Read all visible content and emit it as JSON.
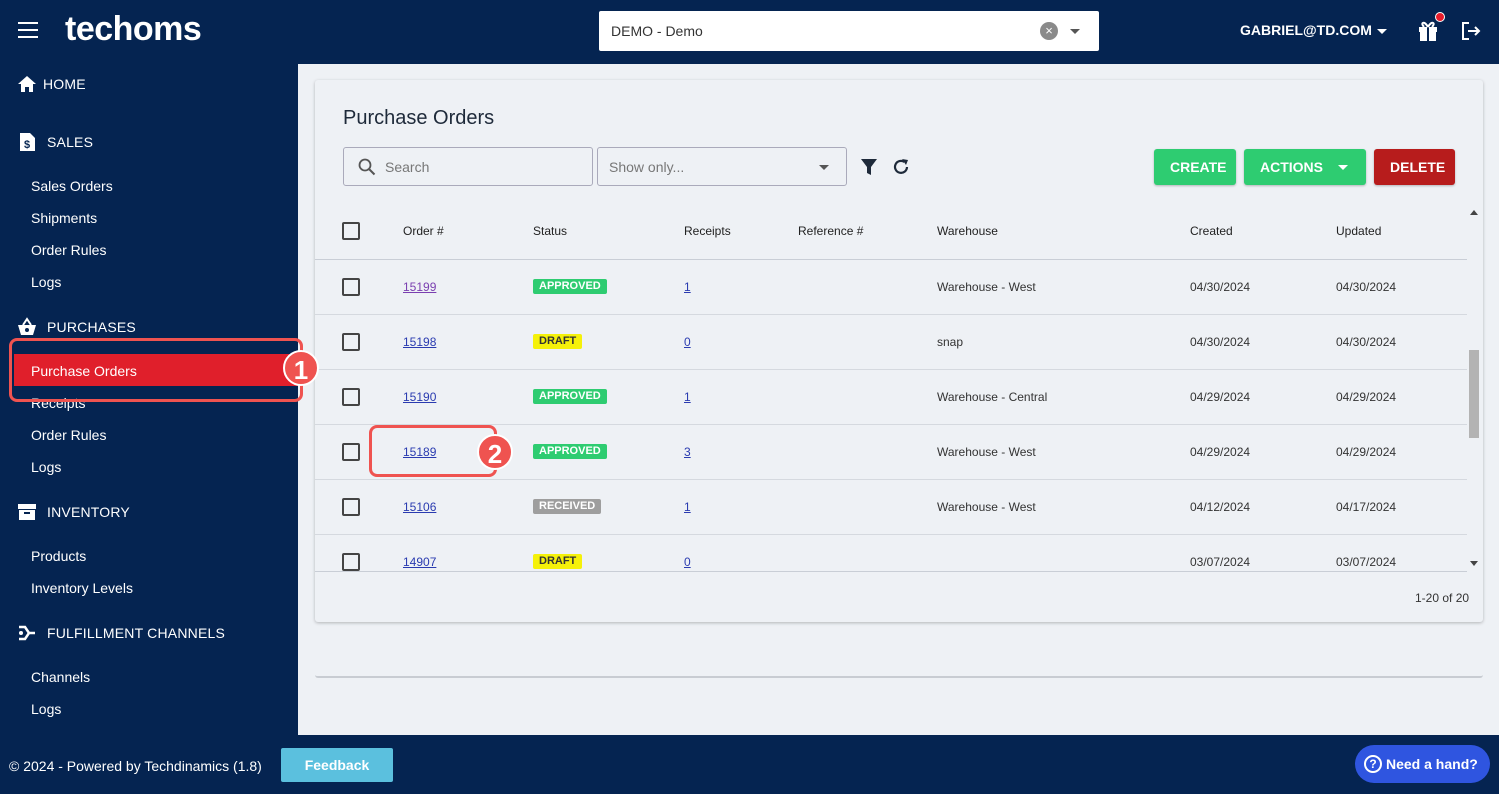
{
  "header": {
    "logo": "techoms",
    "company_select_value": "DEMO - Demo",
    "user": "GABRIEL@TD.COM"
  },
  "sidebar": {
    "sections": [
      {
        "label": "HOME",
        "icon": "home-icon"
      },
      {
        "label": "SALES",
        "icon": "dollar-file-icon",
        "items": [
          "Sales Orders",
          "Shipments",
          "Order Rules",
          "Logs"
        ]
      },
      {
        "label": "PURCHASES",
        "icon": "basket-icon",
        "items": [
          "Purchase Orders",
          "Receipts",
          "Order Rules",
          "Logs"
        ]
      },
      {
        "label": "INVENTORY",
        "icon": "archive-icon",
        "items": [
          "Products",
          "Inventory Levels"
        ]
      },
      {
        "label": "FULFILLMENT CHANNELS",
        "icon": "channels-icon",
        "items": [
          "Channels",
          "Logs"
        ]
      }
    ],
    "active_item": "Purchase Orders"
  },
  "main": {
    "title": "Purchase Orders",
    "search_placeholder": "Search",
    "show_only_placeholder": "Show only...",
    "buttons": {
      "create": "CREATE",
      "actions": "ACTIONS",
      "delete": "DELETE"
    },
    "columns": [
      "Order #",
      "Status",
      "Receipts",
      "Reference #",
      "Warehouse",
      "Created",
      "Updated"
    ],
    "rows": [
      {
        "order": "15199",
        "status": "APPROVED",
        "receipts": "1",
        "reference": "",
        "warehouse": "Warehouse - West",
        "created": "04/30/2024",
        "updated": "04/30/2024"
      },
      {
        "order": "15198",
        "status": "DRAFT",
        "receipts": "0",
        "reference": "",
        "warehouse": "snap",
        "created": "04/30/2024",
        "updated": "04/30/2024"
      },
      {
        "order": "15190",
        "status": "APPROVED",
        "receipts": "1",
        "reference": "",
        "warehouse": "Warehouse - Central",
        "created": "04/29/2024",
        "updated": "04/29/2024"
      },
      {
        "order": "15189",
        "status": "APPROVED",
        "receipts": "3",
        "reference": "",
        "warehouse": "Warehouse - West",
        "created": "04/29/2024",
        "updated": "04/29/2024"
      },
      {
        "order": "15106",
        "status": "RECEIVED",
        "receipts": "1",
        "reference": "",
        "warehouse": "Warehouse - West",
        "created": "04/12/2024",
        "updated": "04/17/2024"
      },
      {
        "order": "14907",
        "status": "DRAFT",
        "receipts": "0",
        "reference": "",
        "warehouse": "",
        "created": "03/07/2024",
        "updated": "03/07/2024"
      }
    ],
    "pagination": "1-20 of 20"
  },
  "annotations": {
    "step1": "1",
    "step2": "2"
  },
  "footer": {
    "copyright": "© 2024 - Powered by Techdinamics (1.8)",
    "feedback": "Feedback",
    "help": "Need a hand?"
  },
  "colors": {
    "navy": "#052451",
    "active": "#e01f2b",
    "green": "#2ecc71",
    "delete_red": "#b71c1c",
    "annotation": "#ef5350"
  }
}
